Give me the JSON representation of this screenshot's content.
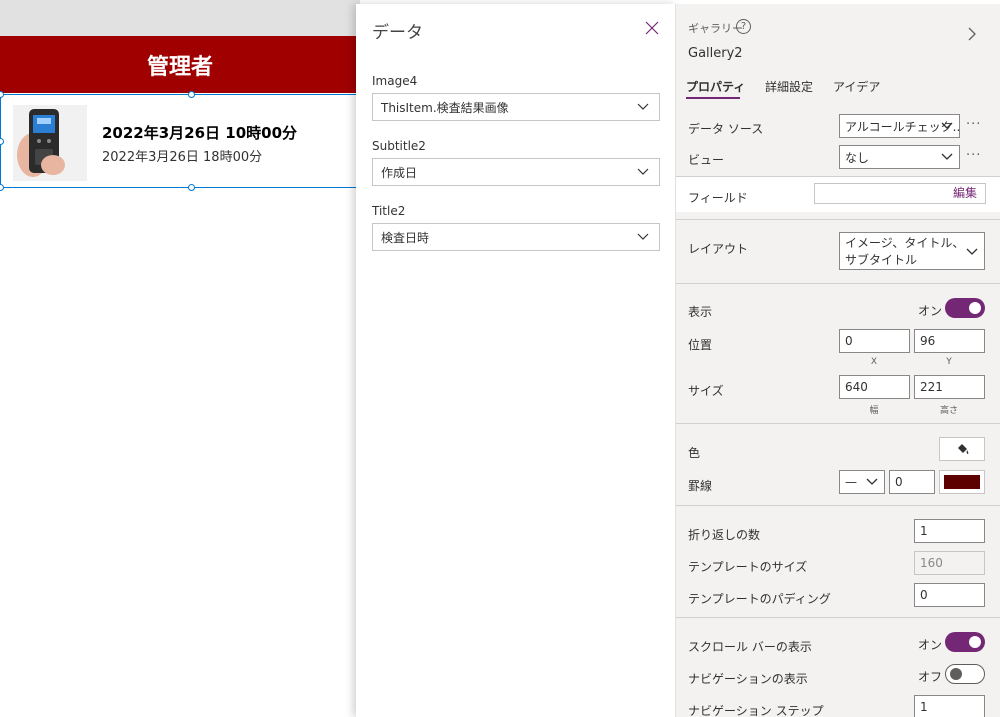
{
  "canvas": {
    "header_title": "管理者",
    "gallery_item": {
      "title": "2022年3月26日 10時00分",
      "subtitle": "2022年3月26日 18時00分"
    }
  },
  "data_panel": {
    "title": "データ",
    "fields": [
      {
        "label": "Image4",
        "value": "ThisItem.検査結果画像"
      },
      {
        "label": "Subtitle2",
        "value": "作成日"
      },
      {
        "label": "Title2",
        "value": "検査日時"
      }
    ]
  },
  "properties": {
    "control_type": "ギャラリー",
    "control_name": "Gallery2",
    "tabs": [
      "プロパティ",
      "詳細設定",
      "アイデア"
    ],
    "data_source_label": "データ ソース",
    "data_source_value": "アルコールチェック...",
    "view_label": "ビュー",
    "view_value": "なし",
    "fields_label": "フィールド",
    "fields_edit": "編集",
    "layout_label": "レイアウト",
    "layout_value_line1": "イメージ、タイトル、",
    "layout_value_line2": "サブタイトル",
    "visible_label": "表示",
    "visible_state": "オン",
    "position_label": "位置",
    "position_x": "0",
    "position_y": "96",
    "x_label": "X",
    "y_label": "Y",
    "size_label": "サイズ",
    "size_w": "640",
    "size_h": "221",
    "w_label": "幅",
    "h_label": "高さ",
    "color_label": "色",
    "border_label": "罫線",
    "border_style": "—",
    "border_width": "0",
    "border_color": "#5c0000",
    "wrap_label": "折り返しの数",
    "wrap_value": "1",
    "template_size_label": "テンプレートのサイズ",
    "template_size_value": "160",
    "template_padding_label": "テンプレートのパディング",
    "template_padding_value": "0",
    "scrollbar_label": "スクロール バーの表示",
    "scrollbar_state": "オン",
    "navigation_label": "ナビゲーションの表示",
    "navigation_state": "オフ",
    "nav_step_label": "ナビゲーション ステップ",
    "nav_step_value": "1"
  },
  "colors": {
    "header": "#a00000",
    "accent": "#742774",
    "selection": "#0078d4"
  }
}
